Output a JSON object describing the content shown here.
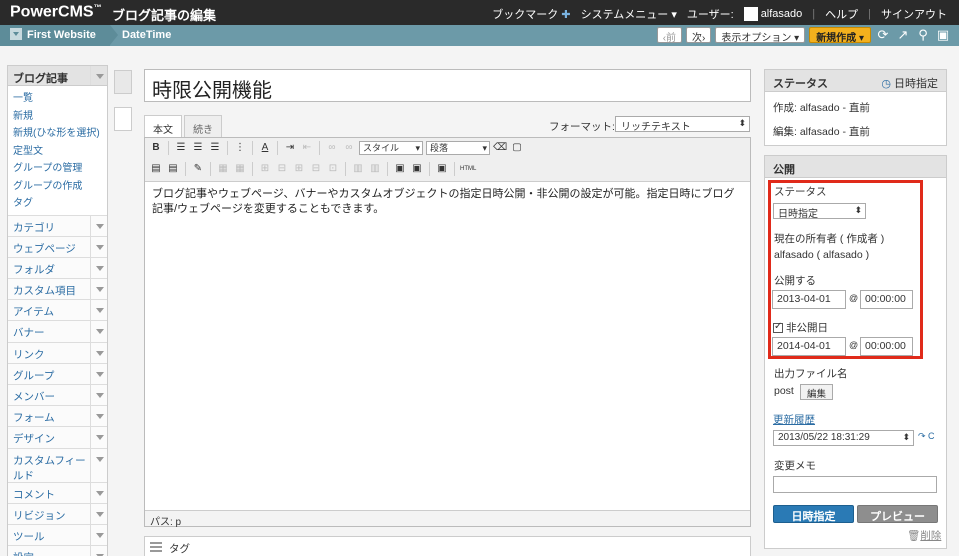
{
  "topbar": {
    "logo": "PowerCMS",
    "logo_tm": "™",
    "page_heading": "ブログ記事の編集",
    "bookmark": "ブックマーク",
    "system_menu": "システムメニュー",
    "user_label": "ユーザー:",
    "user_name": "alfasado",
    "help": "ヘルプ",
    "signout": "サインアウト"
  },
  "bar2": {
    "site_name": "First Website",
    "crumb": "DateTime",
    "prev": "前",
    "next": "次",
    "display_options": "表示オプション",
    "new": "新規作成"
  },
  "sidebar": {
    "head": "ブログ記事",
    "sub_items": [
      "一覧",
      "新規",
      "新規(ひな形を選択)",
      "定型文",
      "グループの管理",
      "グループの作成",
      "タグ"
    ],
    "items": [
      "カテゴリ",
      "ウェブページ",
      "フォルダ",
      "カスタム項目",
      "アイテム",
      "バナー",
      "リンク",
      "グループ",
      "メンバー",
      "フォーム",
      "デザイン",
      "カスタムフィールド",
      "コメント",
      "リビジョン",
      "ツール",
      "設定"
    ]
  },
  "editor": {
    "title": "時限公開機能",
    "tab_body": "本文",
    "tab_more": "続き",
    "format_label": "フォーマット:",
    "format_value": "リッチテキスト",
    "style_select": "スタイル",
    "paragraph_select": "段落",
    "html_label": "HTML",
    "content": "ブログ記事やウェブページ、バナーやカスタムオブジェクトの指定日時公開・非公開の設定が可能。指定日時にブログ記事/ウェブページを変更することもできます。",
    "path": "パス: p"
  },
  "tags_label": "タグ",
  "status_panel": {
    "head": "ステータス",
    "head_right": "日時指定",
    "created": "作成: alfasado - 直前",
    "edited": "編集: alfasado - 直前"
  },
  "publish_panel": {
    "head": "公開",
    "status_label": "ステータス",
    "status_value": "日時指定",
    "owner_label": "現在の所有者 ( 作成者 )",
    "owner_value": "alfasado ( alfasado )",
    "publish_label": "公開する",
    "publish_date": "2013-04-01",
    "publish_time": "00:00:00",
    "at": "@",
    "unpublish_label": "非公開日",
    "unpublish_date": "2014-04-01",
    "unpublish_time": "00:00:00",
    "output_label": "出力ファイル名",
    "output_value": "post",
    "edit_button": "編集",
    "history_link": "更新履歴",
    "history_value": "2013/05/22 18:31:29",
    "change_memo_label": "変更メモ",
    "schedule_button": "日時指定",
    "preview_button": "プレビュー",
    "delete_link": "削除"
  }
}
